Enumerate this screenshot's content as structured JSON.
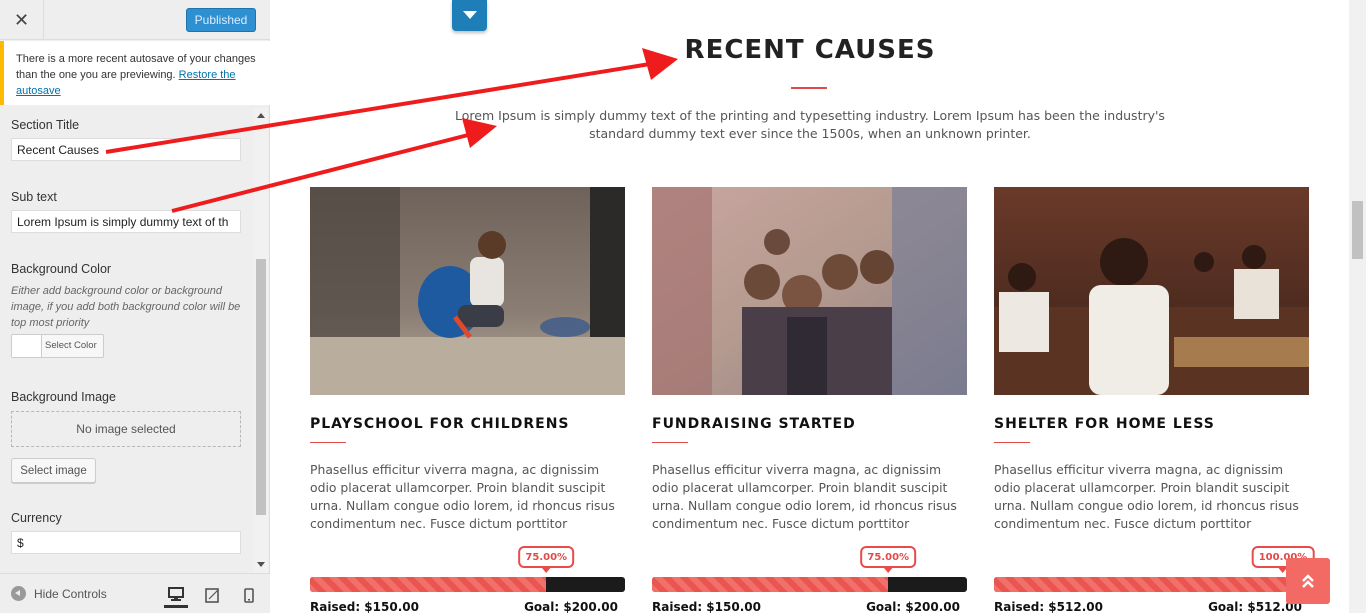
{
  "sidebar": {
    "close_glyph": "✕",
    "publish_label": "Published",
    "notice_text": "There is a more recent autosave of your changes than the one you are previewing. ",
    "notice_link": "Restore the autosave",
    "controls": {
      "section_title_label": "Section Title",
      "section_title_value": "Recent Causes",
      "sub_text_label": "Sub text",
      "sub_text_value": "Lorem Ipsum is simply dummy text of th",
      "bg_color_label": "Background Color",
      "bg_color_desc": "Either add background color or background image, if you add both background color will be top most priority",
      "select_color_label": "Select Color",
      "bg_image_label": "Background Image",
      "no_image_text": "No image selected",
      "select_image_label": "Select image",
      "currency_label": "Currency",
      "currency_value": "$"
    },
    "footer": {
      "hide_controls_label": "Hide Controls",
      "devices": [
        "desktop-icon",
        "tablet-icon",
        "mobile-icon"
      ]
    }
  },
  "preview": {
    "section_title": "RECENT CAUSES",
    "section_sub": "Lorem Ipsum is simply dummy text of the printing and typesetting industry. Lorem Ipsum has been the industry's standard dummy text ever since the 1500s, when an unknown printer.",
    "cards": [
      {
        "title": "PLAYSCHOOL FOR CHILDRENS",
        "desc": "Phasellus efficitur viverra magna, ac dignissim odio placerat ullamcorper. Proin blandit suscipit urna. Nullam congue odio lorem, id rhoncus risus condimentum nec. Fusce dictum porttitor",
        "progress": 0.75,
        "percent_label": "75.00%",
        "raised": "Raised: $150.00",
        "goal": "Goal: $200.00",
        "image": "child-sitting-photo"
      },
      {
        "title": "FUNDRAISING STARTED",
        "desc": "Phasellus efficitur viverra magna, ac dignissim odio placerat ullamcorper. Proin blandit suscipit urna. Nullam congue odio lorem, id rhoncus risus condimentum nec. Fusce dictum porttitor",
        "progress": 0.75,
        "percent_label": "75.00%",
        "raised": "Raised: $150.00",
        "goal": "Goal: $200.00",
        "image": "group-of-children-photo"
      },
      {
        "title": "SHELTER FOR HOME LESS",
        "desc": "Phasellus efficitur viverra magna, ac dignissim odio placerat ullamcorper. Proin blandit suscipit urna. Nullam congue odio lorem, id rhoncus risus condimentum nec. Fusce dictum porttitor",
        "progress": 1.0,
        "percent_label": "100.00%",
        "raised": "Raised: $512.00",
        "goal": "Goal: $512.00",
        "image": "classroom-photo"
      }
    ]
  },
  "colors": {
    "accent": "#e04a4a",
    "publish_blue": "#2e8fd1",
    "notice_yellow": "#ffb900",
    "annotation_red": "#ee1c1c"
  }
}
